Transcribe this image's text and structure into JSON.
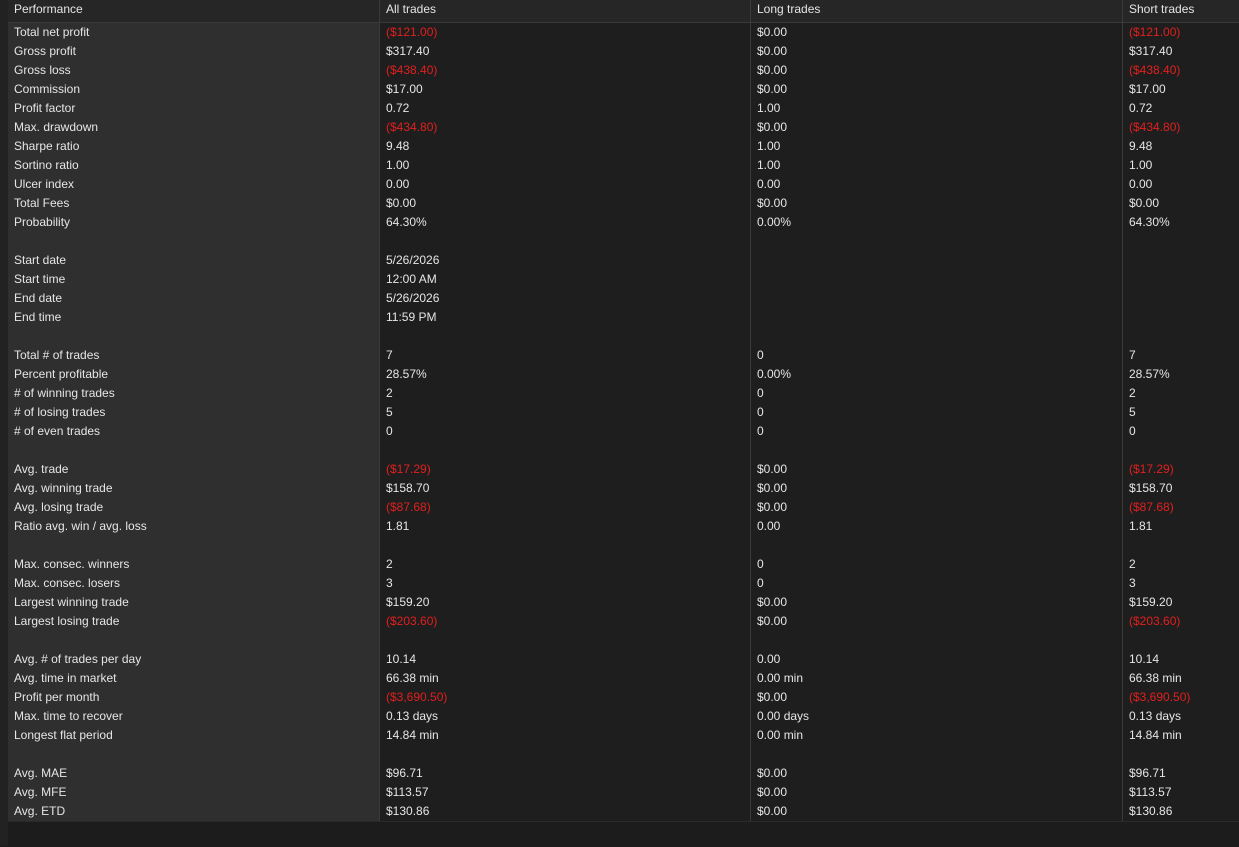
{
  "header": [
    "Performance",
    "All trades",
    "Long trades",
    "Short trades"
  ],
  "rows": [
    {
      "label": "Total net profit",
      "all": "($121.00)",
      "long": "$0.00",
      "short": "($121.00)",
      "neg": [
        true,
        false,
        true
      ]
    },
    {
      "label": "Gross profit",
      "all": "$317.40",
      "long": "$0.00",
      "short": "$317.40",
      "neg": [
        false,
        false,
        false
      ]
    },
    {
      "label": "Gross loss",
      "all": "($438.40)",
      "long": "$0.00",
      "short": "($438.40)",
      "neg": [
        true,
        false,
        true
      ]
    },
    {
      "label": "Commission",
      "all": "$17.00",
      "long": "$0.00",
      "short": "$17.00",
      "neg": [
        false,
        false,
        false
      ]
    },
    {
      "label": "Profit factor",
      "all": "0.72",
      "long": "1.00",
      "short": "0.72",
      "neg": [
        false,
        false,
        false
      ]
    },
    {
      "label": "Max. drawdown",
      "all": "($434.80)",
      "long": "$0.00",
      "short": "($434.80)",
      "neg": [
        true,
        false,
        true
      ]
    },
    {
      "label": "Sharpe ratio",
      "all": "9.48",
      "long": "1.00",
      "short": "9.48",
      "neg": [
        false,
        false,
        false
      ]
    },
    {
      "label": "Sortino ratio",
      "all": "1.00",
      "long": "1.00",
      "short": "1.00",
      "neg": [
        false,
        false,
        false
      ]
    },
    {
      "label": "Ulcer index",
      "all": "0.00",
      "long": "0.00",
      "short": "0.00",
      "neg": [
        false,
        false,
        false
      ]
    },
    {
      "label": "Total Fees",
      "all": "$0.00",
      "long": "$0.00",
      "short": "$0.00",
      "neg": [
        false,
        false,
        false
      ]
    },
    {
      "label": "Probability",
      "all": "64.30%",
      "long": "0.00%",
      "short": "64.30%",
      "neg": [
        false,
        false,
        false
      ]
    },
    {
      "label": "",
      "all": "",
      "long": "",
      "short": "",
      "neg": [
        false,
        false,
        false
      ]
    },
    {
      "label": "Start date",
      "all": "5/26/2026",
      "long": "",
      "short": "",
      "neg": [
        false,
        false,
        false
      ]
    },
    {
      "label": "Start time",
      "all": "12:00 AM",
      "long": "",
      "short": "",
      "neg": [
        false,
        false,
        false
      ]
    },
    {
      "label": "End date",
      "all": "5/26/2026",
      "long": "",
      "short": "",
      "neg": [
        false,
        false,
        false
      ]
    },
    {
      "label": "End time",
      "all": "11:59 PM",
      "long": "",
      "short": "",
      "neg": [
        false,
        false,
        false
      ]
    },
    {
      "label": "",
      "all": "",
      "long": "",
      "short": "",
      "neg": [
        false,
        false,
        false
      ]
    },
    {
      "label": "Total # of trades",
      "all": "7",
      "long": "0",
      "short": "7",
      "neg": [
        false,
        false,
        false
      ]
    },
    {
      "label": "Percent profitable",
      "all": "28.57%",
      "long": "0.00%",
      "short": "28.57%",
      "neg": [
        false,
        false,
        false
      ]
    },
    {
      "label": "# of winning trades",
      "all": "2",
      "long": "0",
      "short": "2",
      "neg": [
        false,
        false,
        false
      ]
    },
    {
      "label": "# of losing trades",
      "all": "5",
      "long": "0",
      "short": "5",
      "neg": [
        false,
        false,
        false
      ]
    },
    {
      "label": "# of even trades",
      "all": "0",
      "long": "0",
      "short": "0",
      "neg": [
        false,
        false,
        false
      ]
    },
    {
      "label": "",
      "all": "",
      "long": "",
      "short": "",
      "neg": [
        false,
        false,
        false
      ]
    },
    {
      "label": "Avg. trade",
      "all": "($17.29)",
      "long": "$0.00",
      "short": "($17.29)",
      "neg": [
        true,
        false,
        true
      ]
    },
    {
      "label": "Avg. winning trade",
      "all": "$158.70",
      "long": "$0.00",
      "short": "$158.70",
      "neg": [
        false,
        false,
        false
      ]
    },
    {
      "label": "Avg. losing trade",
      "all": "($87.68)",
      "long": "$0.00",
      "short": "($87.68)",
      "neg": [
        true,
        false,
        true
      ]
    },
    {
      "label": "Ratio avg. win / avg. loss",
      "all": "1.81",
      "long": "0.00",
      "short": "1.81",
      "neg": [
        false,
        false,
        false
      ]
    },
    {
      "label": "",
      "all": "",
      "long": "",
      "short": "",
      "neg": [
        false,
        false,
        false
      ]
    },
    {
      "label": "Max. consec. winners",
      "all": "2",
      "long": "0",
      "short": "2",
      "neg": [
        false,
        false,
        false
      ]
    },
    {
      "label": "Max. consec. losers",
      "all": "3",
      "long": "0",
      "short": "3",
      "neg": [
        false,
        false,
        false
      ]
    },
    {
      "label": "Largest winning trade",
      "all": "$159.20",
      "long": "$0.00",
      "short": "$159.20",
      "neg": [
        false,
        false,
        false
      ]
    },
    {
      "label": "Largest losing trade",
      "all": "($203.60)",
      "long": "$0.00",
      "short": "($203.60)",
      "neg": [
        true,
        false,
        true
      ]
    },
    {
      "label": "",
      "all": "",
      "long": "",
      "short": "",
      "neg": [
        false,
        false,
        false
      ]
    },
    {
      "label": "Avg. # of trades per day",
      "all": "10.14",
      "long": "0.00",
      "short": "10.14",
      "neg": [
        false,
        false,
        false
      ]
    },
    {
      "label": "Avg. time in market",
      "all": "66.38 min",
      "long": "0.00 min",
      "short": "66.38 min",
      "neg": [
        false,
        false,
        false
      ]
    },
    {
      "label": "Profit per month",
      "all": "($3,690.50)",
      "long": "$0.00",
      "short": "($3,690.50)",
      "neg": [
        true,
        false,
        true
      ]
    },
    {
      "label": "Max. time to recover",
      "all": "0.13 days",
      "long": "0.00 days",
      "short": "0.13 days",
      "neg": [
        false,
        false,
        false
      ]
    },
    {
      "label": "Longest flat period",
      "all": "14.84 min",
      "long": "0.00 min",
      "short": "14.84 min",
      "neg": [
        false,
        false,
        false
      ]
    },
    {
      "label": "",
      "all": "",
      "long": "",
      "short": "",
      "neg": [
        false,
        false,
        false
      ]
    },
    {
      "label": "Avg. MAE",
      "all": "$96.71",
      "long": "$0.00",
      "short": "$96.71",
      "neg": [
        false,
        false,
        false
      ]
    },
    {
      "label": "Avg. MFE",
      "all": "$113.57",
      "long": "$0.00",
      "short": "$113.57",
      "neg": [
        false,
        false,
        false
      ]
    },
    {
      "label": "Avg. ETD",
      "all": "$130.86",
      "long": "$0.00",
      "short": "$130.86",
      "neg": [
        false,
        false,
        false
      ]
    }
  ],
  "colors": {
    "negative": "#e0201e",
    "text": "#e6e6e6",
    "background": "#1b1b1b",
    "label_column": "#2f2f2f"
  }
}
